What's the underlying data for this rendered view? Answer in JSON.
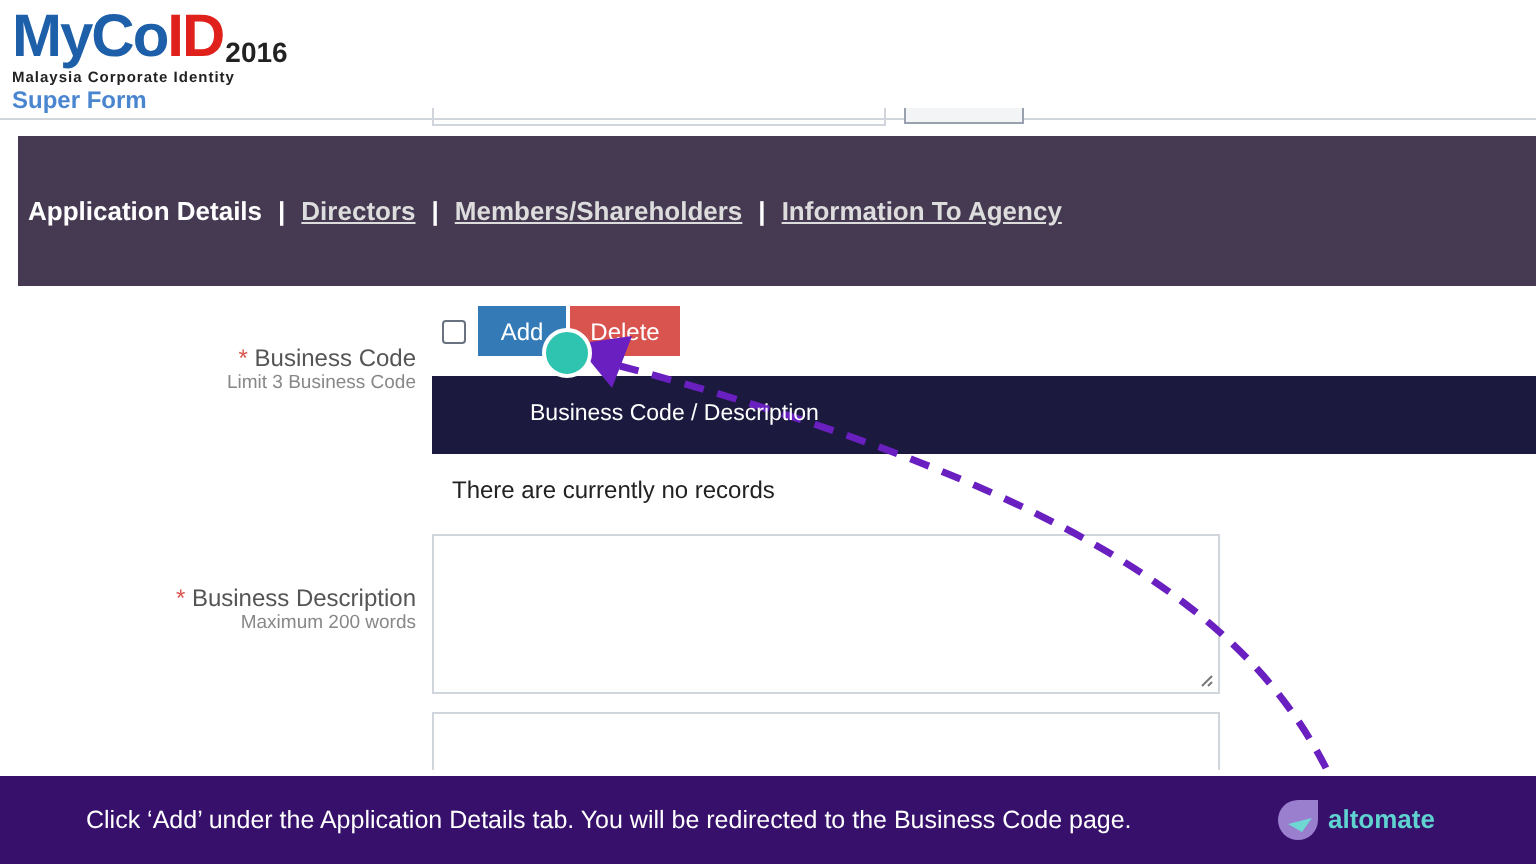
{
  "header": {
    "logo_parts": [
      {
        "text": "MyCo",
        "color": "#1d5fa8"
      },
      {
        "text": "ID",
        "color": "#e0201b"
      }
    ],
    "year": "2016",
    "tagline": "Malaysia Corporate Identity",
    "subtitle": "Super Form"
  },
  "tabs": [
    {
      "label": "Application Details",
      "selected": true
    },
    {
      "label": "Directors",
      "selected": false
    },
    {
      "label": "Members/Shareholders",
      "selected": false
    },
    {
      "label": "Information To Agency",
      "selected": false
    }
  ],
  "tab_separator": "|",
  "business_code": {
    "label": "Business Code",
    "hint": "Limit 3 Business Code",
    "required": true,
    "checked": false,
    "buttons": [
      {
        "label": "Add",
        "kind": "add"
      },
      {
        "label": "Delete",
        "kind": "delete"
      }
    ],
    "column": "Business Code / Description",
    "empty_text": "There are currently no records"
  },
  "business_description": {
    "label": "Business Description",
    "hint": "Maximum 200 words",
    "required": true
  },
  "required_mark": "*",
  "caption": {
    "text": "Click ‘Add’ under the Application Details tab. You will be redirected to the Business Code page.",
    "brand": "altomate"
  }
}
